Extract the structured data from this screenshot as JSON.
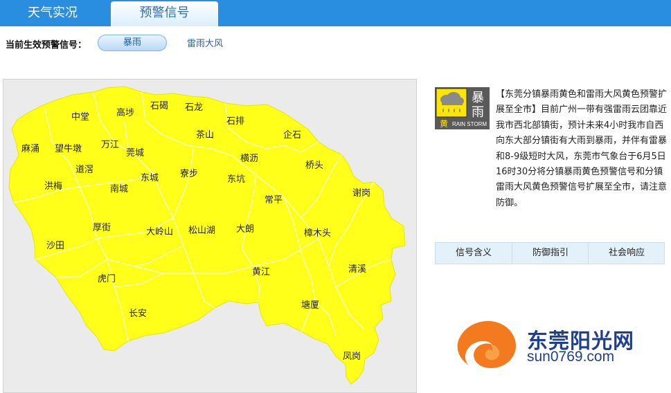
{
  "tabs": {
    "weather": "天气实况",
    "warning": "预警信号"
  },
  "active_signals": {
    "label": "当前生效预警信号：",
    "items": [
      "暴雨",
      "雷雨大风"
    ]
  },
  "map": {
    "towns": [
      "中堂",
      "高埗",
      "石碣",
      "石龙",
      "石排",
      "茶山",
      "企石",
      "麻涌",
      "望牛墩",
      "万江",
      "莞城",
      "道滘",
      "东城",
      "寮步",
      "横沥",
      "桥头",
      "洪梅",
      "南城",
      "东坑",
      "谢岗",
      "常平",
      "厚街",
      "大岭山",
      "松山湖",
      "大朗",
      "樟木头",
      "沙田",
      "黄江",
      "清溪",
      "虎门",
      "塘厦",
      "长安",
      "凤岗"
    ],
    "fill": "#ffff1a"
  },
  "warning_icon": {
    "top": "暴",
    "bottom": "雨",
    "level": "黄",
    "en": "RAIN STORM"
  },
  "warning_text": "【东莞分镇暴雨黄色和雷雨大风黄色预警扩展至全市】目前广州一带有强雷雨云团靠近我市西北部镇街，预计未来4小时我市自西向东大部分镇街有大雨到暴雨，并伴有雷暴和8-9级短时大风，东莞市气象台于6月5日16时30分将分镇暴雨黄色预警信号和分镇雷雨大风黄色预警信号扩展至全市，请注意防御。",
  "info_tabs": [
    "信号含义",
    "防御指引",
    "社会响应"
  ],
  "brand": {
    "name": "东莞阳光网",
    "url": "sun0769.com"
  }
}
